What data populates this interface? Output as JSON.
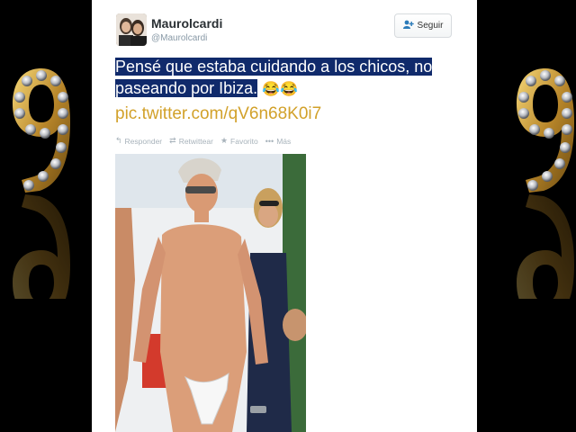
{
  "tweet": {
    "author_name": "Maurolcardi",
    "author_handle": "@Maurolcardi",
    "follow_label": "Seguir",
    "text_line1": "Pensé que estaba cuidando a los chicos, no",
    "text_line2": "paseando por Ibiza.",
    "emojis": "😂😂",
    "link": "pic.twitter.com/qV6n68K0i7",
    "actions": {
      "reply": "Responder",
      "retweet": "Retwittear",
      "favorite": "Favorito",
      "more": "Más"
    }
  },
  "colors": {
    "highlight": "#102a6b",
    "link": "#d2a12a",
    "follow_icon": "#2b7bb9",
    "background": "#000000"
  },
  "icons": [
    "follow-icon",
    "reply-icon",
    "retweet-icon",
    "star-icon",
    "more-icon"
  ]
}
